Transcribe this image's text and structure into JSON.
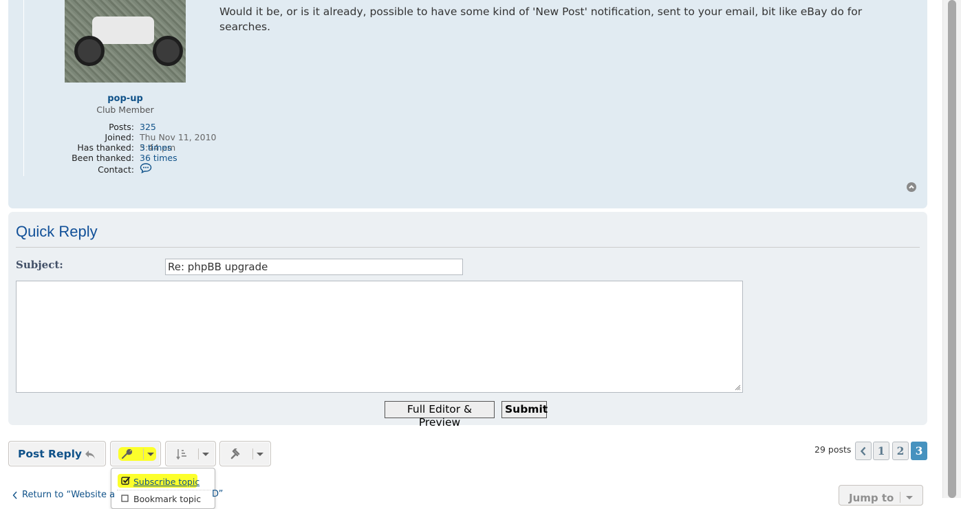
{
  "post": {
    "author": {
      "username": "pop-up",
      "rank": "Club Member",
      "posts_label": "Posts:",
      "posts_value": "325",
      "joined_label": "Joined:",
      "joined_value": "Thu Nov 11, 2010 5:44 pm",
      "has_thanked_label": "Has thanked:",
      "has_thanked_value": "3 times",
      "been_thanked_label": "Been thanked:",
      "been_thanked_value": "36 times",
      "contact_label": "Contact:",
      "contact_icon": "chat-bubble-icon"
    },
    "body": "Would it be, or is it already, possible to have some kind of 'New Post' notification, sent to your email, bit like eBay do for searches.",
    "top_icon": "chevron-up-circle-icon"
  },
  "quick_reply": {
    "title": "Quick Reply",
    "subject_label": "Subject:",
    "subject_value": "Re: phpBB upgrade",
    "message_value": "",
    "full_editor_label": "Full Editor & Preview",
    "submit_label": "Submit"
  },
  "action_bar": {
    "post_reply_label": "Post Reply",
    "post_reply_icon": "reply-arrow-icon",
    "tools_icon": "wrench-icon",
    "sort_icon": "sort-icon",
    "moderator_icon": "gavel-icon",
    "dropdown": {
      "subscribe_label": "Subscribe topic",
      "bookmark_label": "Bookmark topic"
    },
    "posts_count": "29 posts",
    "pagination": {
      "prev_icon": "chevron-left-icon",
      "pages": [
        "1",
        "2",
        "3"
      ],
      "current": "3"
    },
    "return_link": "Return to “Website a",
    "return_link_tail": "D”",
    "jump_to_label": "Jump to"
  },
  "colors": {
    "post_bg": "#e1ebf2",
    "quick_reply_bg": "#ecf0f3",
    "link": "#105289",
    "highlight": "#fcff2b",
    "active_page": "#4692bf"
  }
}
